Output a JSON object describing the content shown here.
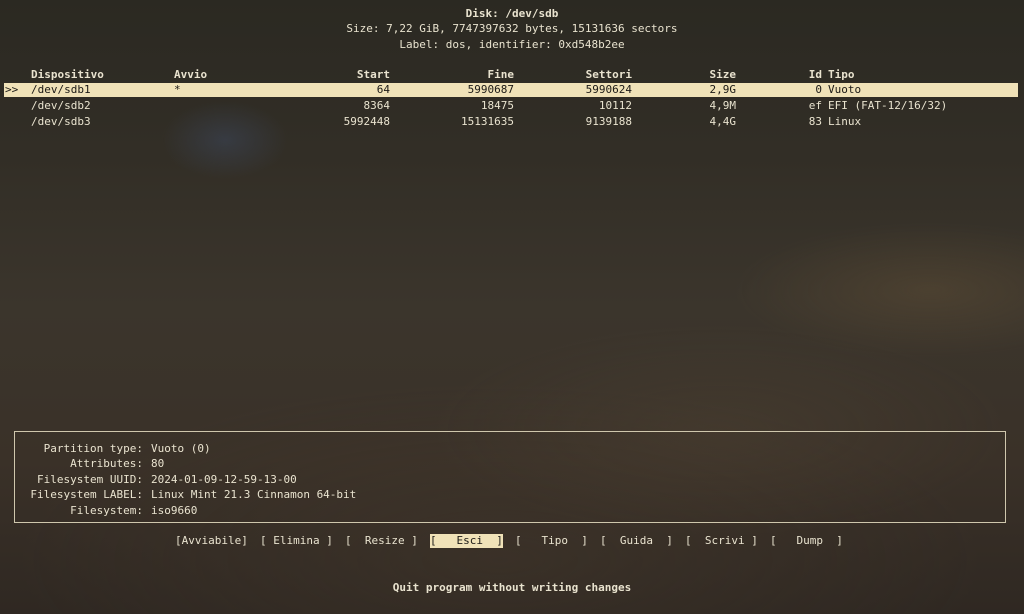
{
  "header": {
    "disk": "Disk: /dev/sdb",
    "size": "Size: 7,22 GiB, 7747397632 bytes, 15131636 sectors",
    "label": "Label: dos, identifier: 0xd548b2ee"
  },
  "table": {
    "columns": {
      "device": "Dispositivo",
      "boot": "Avvio",
      "start": "Start",
      "end": "Fine",
      "sectors": "Settori",
      "size": "Size",
      "id": "Id",
      "type": "Tipo"
    },
    "selected_marker": ">>",
    "rows": [
      {
        "device": "/dev/sdb1",
        "boot": "*",
        "start": "64",
        "end": "5990687",
        "sectors": "5990624",
        "size": "2,9G",
        "id": "0",
        "type": "Vuoto"
      },
      {
        "device": "/dev/sdb2",
        "boot": "",
        "start": "8364",
        "end": "18475",
        "sectors": "10112",
        "size": "4,9M",
        "id": "ef",
        "type": "EFI (FAT-12/16/32)"
      },
      {
        "device": "/dev/sdb3",
        "boot": "",
        "start": "5992448",
        "end": "15131635",
        "sectors": "9139188",
        "size": "4,4G",
        "id": "83",
        "type": "Linux"
      }
    ]
  },
  "info": [
    {
      "label": "Partition type:",
      "value": "Vuoto (0)"
    },
    {
      "label": "Attributes:",
      "value": "80"
    },
    {
      "label": "Filesystem UUID:",
      "value": "2024-01-09-12-59-13-00"
    },
    {
      "label": "Filesystem LABEL:",
      "value": "Linux Mint 21.3 Cinnamon 64-bit"
    },
    {
      "label": "Filesystem:",
      "value": "iso9660"
    }
  ],
  "menu": {
    "bootable": "[Avviabile]",
    "delete": "[ Elimina ]",
    "resize": "[  Resize ]",
    "quit": "[   Esci  ]",
    "type": "[   Tipo  ]",
    "help": "[  Guida  ]",
    "write": "[  Scrivi ]",
    "dump": "[   Dump  ]"
  },
  "status": "Quit program without writing changes",
  "colors": {
    "selection_bg": "#f0e2b8",
    "text": "#e9e3cf",
    "border": "#cfc7ad"
  }
}
